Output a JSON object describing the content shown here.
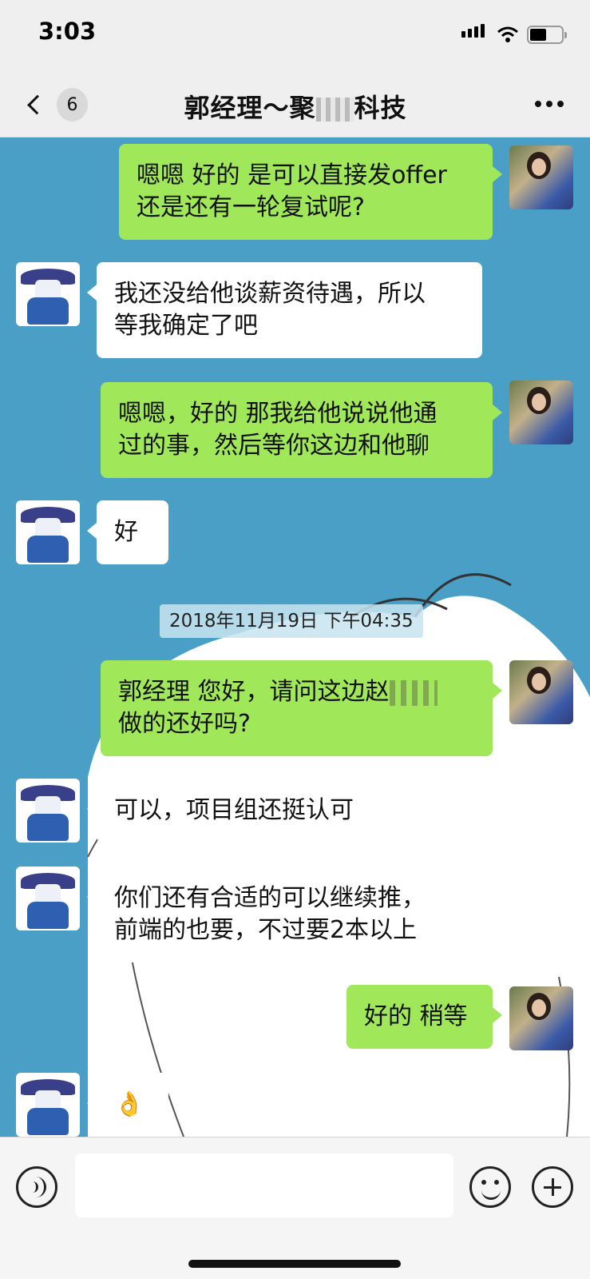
{
  "status": {
    "time": "3:03"
  },
  "nav": {
    "back_count": "6",
    "title_prefix": "郭经理～聚",
    "title_suffix": "科技"
  },
  "timestamp": "2018年11月19日 下午04:35",
  "messages": [
    {
      "from": "me",
      "line1": "嗯嗯 好的 是可以直接发offer",
      "line2": "还是还有一轮复试呢?"
    },
    {
      "from": "them",
      "line1": "我还没给他谈薪资待遇，所以",
      "line2": "等我确定了吧"
    },
    {
      "from": "me",
      "line1": "嗯嗯，好的 那我给他说说他通",
      "line2": "过的事，然后等你这边和他聊"
    },
    {
      "from": "them",
      "line1": "好"
    },
    {
      "from": "me",
      "line1": "郭经理 您好，请问这边赵",
      "line2": "做的还好吗?"
    },
    {
      "from": "them",
      "line1": "可以，项目组还挺认可"
    },
    {
      "from": "them",
      "line1": "你们还有合适的可以继续推，",
      "line2": "前端的也要，不过要2本以上"
    },
    {
      "from": "me",
      "line1": "好的 稍等"
    },
    {
      "from": "them",
      "line1": "👌"
    }
  ],
  "icons": {
    "back": "chevron-left-icon",
    "more": "more-icon",
    "voice": "voice-icon",
    "emoji": "emoji-icon",
    "plus": "plus-icon"
  },
  "colors": {
    "chat_background": "#4a9fc6",
    "my_bubble": "#a0e75a",
    "their_bubble": "#ffffff"
  }
}
